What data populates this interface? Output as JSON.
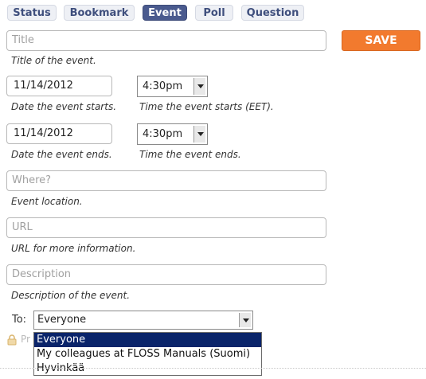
{
  "tabs": [
    {
      "label": "Status"
    },
    {
      "label": "Bookmark"
    },
    {
      "label": "Event",
      "active": true
    },
    {
      "label": "Poll"
    },
    {
      "label": "Question"
    }
  ],
  "title": {
    "placeholder": "Title",
    "help": "Title of the event."
  },
  "start": {
    "date": "11/14/2012",
    "date_help": "Date the event starts.",
    "time": "4:30pm",
    "time_help": "Time the event starts (EET)."
  },
  "end": {
    "date": "11/14/2012",
    "date_help": "Date the event ends.",
    "time": "4:30pm",
    "time_help": "Time the event ends."
  },
  "where": {
    "placeholder": "Where?",
    "help": "Event location."
  },
  "url": {
    "placeholder": "URL",
    "help": "URL for more information."
  },
  "description": {
    "placeholder": "Description",
    "help": "Description of the event."
  },
  "save_label": "SAVE",
  "to": {
    "label": "To:",
    "selected": "Everyone",
    "options": [
      "Everyone",
      "My colleagues at FLOSS Manuals (Suomi)",
      "Hyvinkää"
    ]
  },
  "private_label": "Pr",
  "colors": {
    "accent": "#f27a2e",
    "tab_active": "#4a5a8e",
    "selection": "#0a246a"
  }
}
